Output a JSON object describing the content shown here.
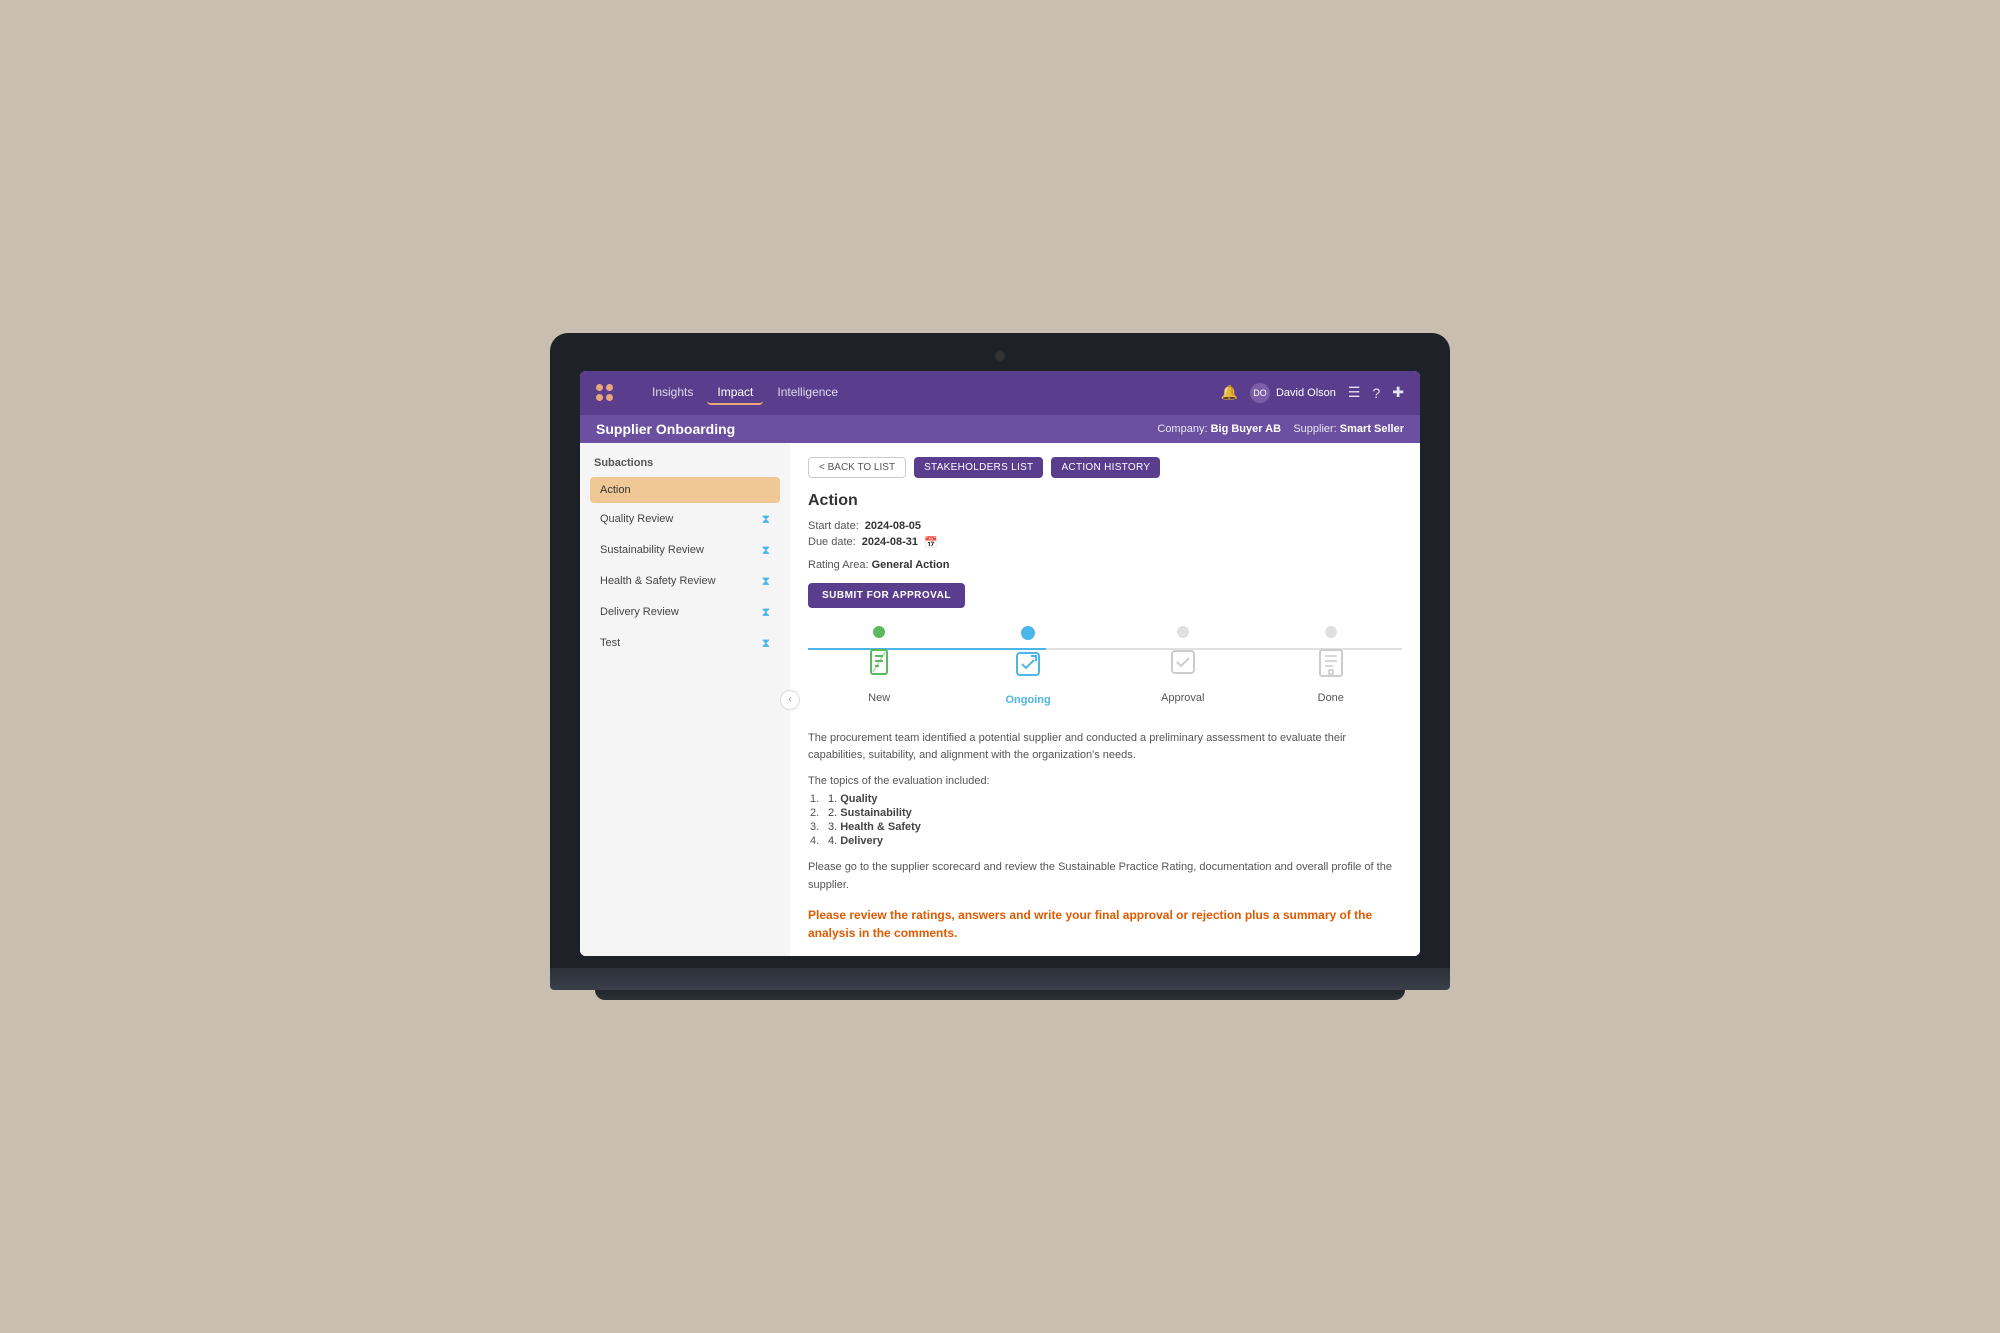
{
  "page": {
    "background": "#c8bfb0"
  },
  "nav": {
    "links": [
      {
        "label": "Insights",
        "active": false
      },
      {
        "label": "Impact",
        "active": true
      },
      {
        "label": "Intelligence",
        "active": false
      }
    ],
    "user": "David Olson",
    "bell_icon": "🔔",
    "menu_icon": "☰",
    "help_icon": "?",
    "add_icon": "✚"
  },
  "sub_header": {
    "title": "Supplier Onboarding",
    "company_label": "Company:",
    "company_name": "Big Buyer AB",
    "supplier_label": "Supplier:",
    "supplier_name": "Smart Seller"
  },
  "sidebar": {
    "section_title": "Subactions",
    "items": [
      {
        "label": "Action",
        "active": true,
        "icon": "active"
      },
      {
        "label": "Quality Review",
        "active": false,
        "icon": "hourglass"
      },
      {
        "label": "Sustainability Review",
        "active": false,
        "icon": "hourglass"
      },
      {
        "label": "Health & Safety Review",
        "active": false,
        "icon": "hourglass"
      },
      {
        "label": "Delivery Review",
        "active": false,
        "icon": "hourglass"
      },
      {
        "label": "Test",
        "active": false,
        "icon": "hourglass"
      }
    ]
  },
  "action": {
    "title": "Action",
    "back_button": "< BACK TO LIST",
    "stakeholders_button": "STAKEHOLDERS LIST",
    "history_button": "ACTION HISTORY",
    "start_date_label": "Start date:",
    "start_date": "2024-08-05",
    "due_date_label": "Due date:",
    "due_date": "2024-08-31",
    "rating_area_label": "Rating Area:",
    "rating_area": "General Action",
    "submit_button": "SUBMIT FOR APPROVAL",
    "timeline": [
      {
        "label": "New",
        "state": "done",
        "icon": "⌛"
      },
      {
        "label": "Ongoing",
        "state": "active",
        "icon": "↪"
      },
      {
        "label": "Approval",
        "state": "inactive",
        "icon": "✓"
      },
      {
        "label": "Done",
        "state": "inactive",
        "icon": "⚑"
      }
    ],
    "description1": "The procurement team identified a potential supplier and conducted a preliminary assessment to evaluate their capabilities, suitability, and alignment with the organization's needs.",
    "topics_intro": "The topics of the evaluation included:",
    "topics": [
      {
        "num": "1",
        "label": "Quality"
      },
      {
        "num": "2",
        "label": "Sustainability"
      },
      {
        "num": "3",
        "label": "Health & Safety"
      },
      {
        "num": "4",
        "label": "Delivery"
      }
    ],
    "scorecard_text": "Please go to the supplier scorecard and review the Sustainable Practice Rating, documentation and overall profile of the supplier.",
    "approval_note": "Please review the ratings, answers and write your final approval or rejection plus a summary of the analysis in the comments."
  }
}
